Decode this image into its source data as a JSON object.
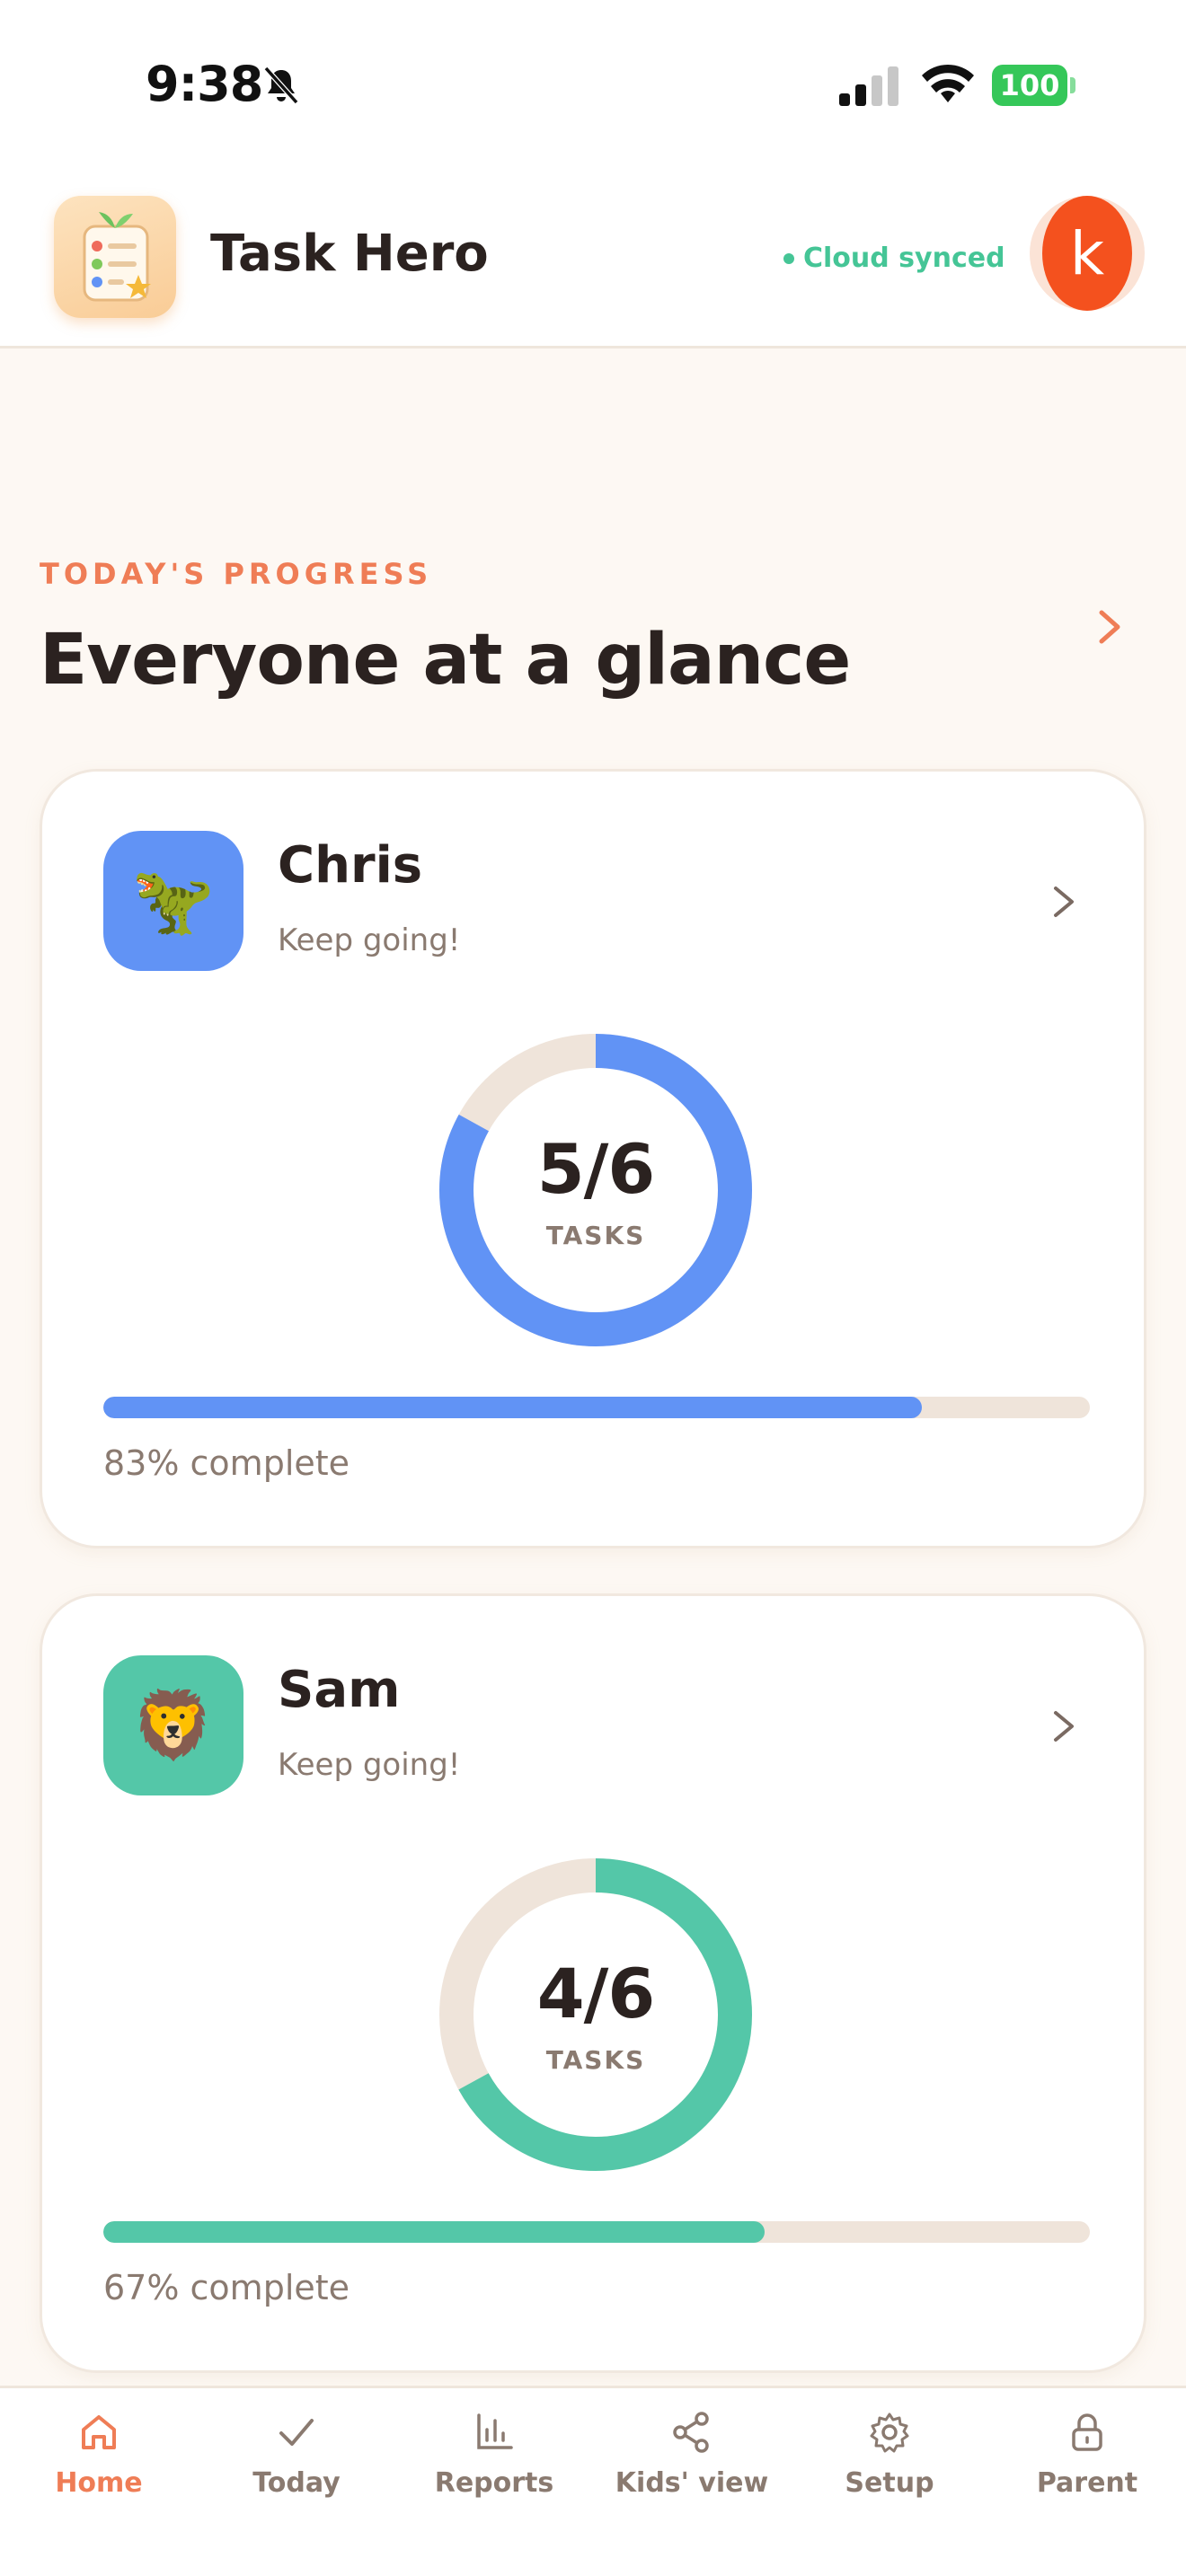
{
  "status_bar": {
    "time": "9:38",
    "battery": "100",
    "icons": [
      "bell-slash-icon",
      "cellular-signal-icon",
      "wifi-icon",
      "battery-icon"
    ]
  },
  "header": {
    "app_title": "Task Hero",
    "sync_status": "Cloud synced",
    "avatar_initial": "k",
    "logo_icon": "checklist-sprout-icon"
  },
  "section": {
    "eyebrow": "TODAY'S PROGRESS",
    "title": "Everyone at a glance"
  },
  "kids": [
    {
      "name": "Chris",
      "subtitle": "Keep going!",
      "emoji": "🦖",
      "avatar_color": "#6193f5",
      "tasks_done": "5/6",
      "tasks_label": "TASKS",
      "progress": 0.83,
      "progress_text": "83% complete",
      "accent": "#6193f5"
    },
    {
      "name": "Sam",
      "subtitle": "Keep going!",
      "emoji": "🦁",
      "avatar_color": "#54c7a8",
      "tasks_done": "4/6",
      "tasks_label": "TASKS",
      "progress": 0.67,
      "progress_text": "67% complete",
      "accent": "#54c7a8"
    }
  ],
  "nav": [
    {
      "label": "Home",
      "icon": "home-icon",
      "active": true
    },
    {
      "label": "Today",
      "icon": "checkmark-icon",
      "active": false
    },
    {
      "label": "Reports",
      "icon": "bar-chart-icon",
      "active": false
    },
    {
      "label": "Kids' view",
      "icon": "share-icon",
      "active": false
    },
    {
      "label": "Setup",
      "icon": "gear-icon",
      "active": false
    },
    {
      "label": "Parent",
      "icon": "lock-icon",
      "active": false
    }
  ],
  "colors": {
    "accent": "#ef7d56",
    "sync_green": "#45c596",
    "track": "#efe4da",
    "muted_text": "#8a7a70"
  }
}
